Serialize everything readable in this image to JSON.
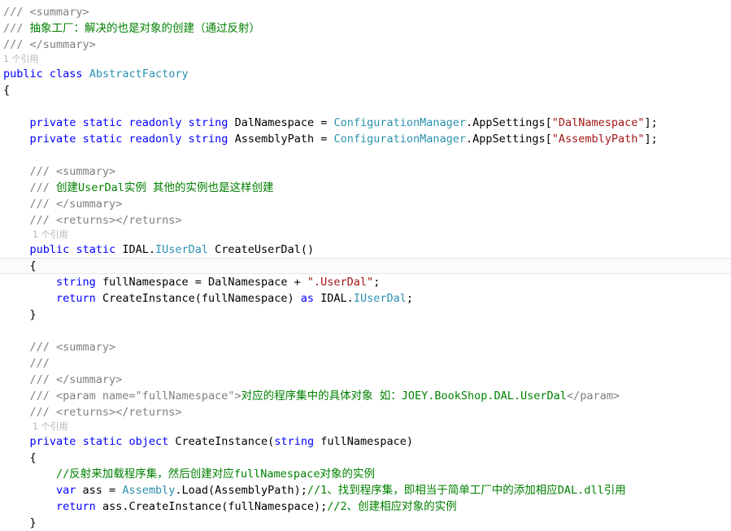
{
  "editor": {
    "language": "csharp",
    "colors": {
      "background": "#ffffff",
      "keyword": "#0000ff",
      "type": "#2b91af",
      "string": "#a31515",
      "comment": "#008000",
      "xml_doc_tag": "#808080",
      "xml_doc_text": "#008000",
      "plain": "#000000",
      "codelens": "#b4b4b4",
      "current_line_bg": "#fbfbfb",
      "current_line_border": "#e6e6e6"
    },
    "codelens_label": "1 个引用",
    "lines": [
      {
        "id": "l1",
        "kind": "doc",
        "indent": 1,
        "tokens": [
          {
            "t": "xml",
            "v": "/// <summary>"
          }
        ]
      },
      {
        "id": "l2",
        "kind": "doc",
        "indent": 1,
        "tokens": [
          {
            "t": "xml",
            "v": "/// "
          },
          {
            "t": "xmltext",
            "v": "抽象工厂：解决的也是对象的创建（通过反射）"
          }
        ]
      },
      {
        "id": "l3",
        "kind": "doc",
        "indent": 1,
        "tokens": [
          {
            "t": "xml",
            "v": "/// </summary>"
          }
        ]
      },
      {
        "id": "l4",
        "kind": "codelens",
        "indent": 1,
        "tokens": [
          {
            "t": "lens",
            "v": "1 个引用"
          }
        ]
      },
      {
        "id": "l5",
        "kind": "code",
        "indent": 1,
        "tokens": [
          {
            "t": "kw",
            "v": "public"
          },
          {
            "t": "plain",
            "v": " "
          },
          {
            "t": "kw",
            "v": "class"
          },
          {
            "t": "plain",
            "v": " "
          },
          {
            "t": "typ",
            "v": "AbstractFactory"
          }
        ]
      },
      {
        "id": "l6",
        "kind": "code",
        "indent": 0,
        "tokens": [
          {
            "t": "punc",
            "v": "{"
          }
        ]
      },
      {
        "id": "l7",
        "kind": "blank",
        "indent": 0,
        "tokens": []
      },
      {
        "id": "l8",
        "kind": "code",
        "indent": 0,
        "tokens": [
          {
            "t": "plain",
            "v": "    "
          },
          {
            "t": "kw",
            "v": "private"
          },
          {
            "t": "plain",
            "v": " "
          },
          {
            "t": "kw",
            "v": "static"
          },
          {
            "t": "plain",
            "v": " "
          },
          {
            "t": "kw",
            "v": "readonly"
          },
          {
            "t": "plain",
            "v": " "
          },
          {
            "t": "kw",
            "v": "string"
          },
          {
            "t": "plain",
            "v": " DalNamespace = "
          },
          {
            "t": "typ",
            "v": "ConfigurationManager"
          },
          {
            "t": "plain",
            "v": ".AppSettings["
          },
          {
            "t": "str",
            "v": "\"DalNamespace\""
          },
          {
            "t": "plain",
            "v": "];"
          }
        ]
      },
      {
        "id": "l9",
        "kind": "code",
        "indent": 0,
        "tokens": [
          {
            "t": "plain",
            "v": "    "
          },
          {
            "t": "kw",
            "v": "private"
          },
          {
            "t": "plain",
            "v": " "
          },
          {
            "t": "kw",
            "v": "static"
          },
          {
            "t": "plain",
            "v": " "
          },
          {
            "t": "kw",
            "v": "readonly"
          },
          {
            "t": "plain",
            "v": " "
          },
          {
            "t": "kw",
            "v": "string"
          },
          {
            "t": "plain",
            "v": " AssemblyPath = "
          },
          {
            "t": "typ",
            "v": "ConfigurationManager"
          },
          {
            "t": "plain",
            "v": ".AppSettings["
          },
          {
            "t": "str",
            "v": "\"AssemblyPath\""
          },
          {
            "t": "plain",
            "v": "];"
          }
        ]
      },
      {
        "id": "l10",
        "kind": "blank",
        "indent": 0,
        "tokens": []
      },
      {
        "id": "l11",
        "kind": "doc",
        "indent": 0,
        "tokens": [
          {
            "t": "plain",
            "v": "    "
          },
          {
            "t": "xml",
            "v": "/// <summary>"
          }
        ]
      },
      {
        "id": "l12",
        "kind": "doc",
        "indent": 0,
        "tokens": [
          {
            "t": "plain",
            "v": "    "
          },
          {
            "t": "xml",
            "v": "/// "
          },
          {
            "t": "xmltext",
            "v": "创建UserDal实例 其他的实例也是这样创建"
          }
        ]
      },
      {
        "id": "l13",
        "kind": "doc",
        "indent": 0,
        "tokens": [
          {
            "t": "plain",
            "v": "    "
          },
          {
            "t": "xml",
            "v": "/// </summary>"
          }
        ]
      },
      {
        "id": "l14",
        "kind": "doc",
        "indent": 0,
        "tokens": [
          {
            "t": "plain",
            "v": "    "
          },
          {
            "t": "xml",
            "v": "/// <returns></returns>"
          }
        ]
      },
      {
        "id": "l15",
        "kind": "codelens",
        "indent": 2,
        "tokens": [
          {
            "t": "lens",
            "v": "1 个引用"
          }
        ]
      },
      {
        "id": "l16",
        "kind": "code",
        "indent": 0,
        "tokens": [
          {
            "t": "plain",
            "v": "    "
          },
          {
            "t": "kw",
            "v": "public"
          },
          {
            "t": "plain",
            "v": " "
          },
          {
            "t": "kw",
            "v": "static"
          },
          {
            "t": "plain",
            "v": " IDAL."
          },
          {
            "t": "typ",
            "v": "IUserDal"
          },
          {
            "t": "plain",
            "v": " CreateUserDal()"
          }
        ]
      },
      {
        "id": "l17",
        "kind": "current",
        "indent": 0,
        "tokens": [
          {
            "t": "plain",
            "v": "    "
          },
          {
            "t": "punc",
            "v": "{"
          }
        ]
      },
      {
        "id": "l18",
        "kind": "code",
        "indent": 0,
        "tokens": [
          {
            "t": "plain",
            "v": "        "
          },
          {
            "t": "kw",
            "v": "string"
          },
          {
            "t": "plain",
            "v": " fullNamespace = DalNamespace + "
          },
          {
            "t": "str",
            "v": "\".UserDal\""
          },
          {
            "t": "plain",
            "v": ";"
          }
        ]
      },
      {
        "id": "l19",
        "kind": "code",
        "indent": 0,
        "tokens": [
          {
            "t": "plain",
            "v": "        "
          },
          {
            "t": "kw",
            "v": "return"
          },
          {
            "t": "plain",
            "v": " CreateInstance(fullNamespace) "
          },
          {
            "t": "kw",
            "v": "as"
          },
          {
            "t": "plain",
            "v": " IDAL."
          },
          {
            "t": "typ",
            "v": "IUserDal"
          },
          {
            "t": "plain",
            "v": ";"
          }
        ]
      },
      {
        "id": "l20",
        "kind": "code",
        "indent": 0,
        "tokens": [
          {
            "t": "plain",
            "v": "    "
          },
          {
            "t": "punc",
            "v": "}"
          }
        ]
      },
      {
        "id": "l21",
        "kind": "blank",
        "indent": 0,
        "tokens": []
      },
      {
        "id": "l22",
        "kind": "doc",
        "indent": 0,
        "tokens": [
          {
            "t": "plain",
            "v": "    "
          },
          {
            "t": "xml",
            "v": "/// <summary>"
          }
        ]
      },
      {
        "id": "l23",
        "kind": "doc",
        "indent": 0,
        "tokens": [
          {
            "t": "plain",
            "v": "    "
          },
          {
            "t": "xml",
            "v": "/// "
          }
        ]
      },
      {
        "id": "l24",
        "kind": "doc",
        "indent": 0,
        "tokens": [
          {
            "t": "plain",
            "v": "    "
          },
          {
            "t": "xml",
            "v": "/// </summary>"
          }
        ]
      },
      {
        "id": "l25",
        "kind": "doc",
        "indent": 0,
        "tokens": [
          {
            "t": "plain",
            "v": "    "
          },
          {
            "t": "xml",
            "v": "/// <param name=\"fullNamespace\">"
          },
          {
            "t": "xmltext",
            "v": "对应的程序集中的具体对象 如：JOEY.BookShop.DAL.UserDal"
          },
          {
            "t": "xml",
            "v": "</param>"
          }
        ]
      },
      {
        "id": "l26",
        "kind": "doc",
        "indent": 0,
        "tokens": [
          {
            "t": "plain",
            "v": "    "
          },
          {
            "t": "xml",
            "v": "/// <returns></returns>"
          }
        ]
      },
      {
        "id": "l27",
        "kind": "codelens",
        "indent": 2,
        "tokens": [
          {
            "t": "lens",
            "v": "1 个引用"
          }
        ]
      },
      {
        "id": "l28",
        "kind": "code",
        "indent": 0,
        "tokens": [
          {
            "t": "plain",
            "v": "    "
          },
          {
            "t": "kw",
            "v": "private"
          },
          {
            "t": "plain",
            "v": " "
          },
          {
            "t": "kw",
            "v": "static"
          },
          {
            "t": "plain",
            "v": " "
          },
          {
            "t": "kw",
            "v": "object"
          },
          {
            "t": "plain",
            "v": " CreateInstance("
          },
          {
            "t": "kw",
            "v": "string"
          },
          {
            "t": "plain",
            "v": " fullNamespace)"
          }
        ]
      },
      {
        "id": "l29",
        "kind": "code",
        "indent": 0,
        "tokens": [
          {
            "t": "plain",
            "v": "    "
          },
          {
            "t": "punc",
            "v": "{"
          }
        ]
      },
      {
        "id": "l30",
        "kind": "code",
        "indent": 0,
        "tokens": [
          {
            "t": "plain",
            "v": "        "
          },
          {
            "t": "cmt",
            "v": "//反射来加载程序集，然后创建对应fullNamespace对象的实例"
          }
        ]
      },
      {
        "id": "l31",
        "kind": "code",
        "indent": 0,
        "tokens": [
          {
            "t": "plain",
            "v": "        "
          },
          {
            "t": "kw",
            "v": "var"
          },
          {
            "t": "plain",
            "v": " ass = "
          },
          {
            "t": "typ",
            "v": "Assembly"
          },
          {
            "t": "plain",
            "v": ".Load(AssemblyPath);"
          },
          {
            "t": "cmt",
            "v": "//1、找到程序集，即相当于简单工厂中的添加相应DAL.dll引用"
          }
        ]
      },
      {
        "id": "l32",
        "kind": "code",
        "indent": 0,
        "tokens": [
          {
            "t": "plain",
            "v": "        "
          },
          {
            "t": "kw",
            "v": "return"
          },
          {
            "t": "plain",
            "v": " ass.CreateInstance(fullNamespace);"
          },
          {
            "t": "cmt",
            "v": "//2、创建相应对象的实例"
          }
        ]
      },
      {
        "id": "l33",
        "kind": "code",
        "indent": 0,
        "tokens": [
          {
            "t": "plain",
            "v": "    "
          },
          {
            "t": "punc",
            "v": "}"
          }
        ]
      }
    ]
  }
}
